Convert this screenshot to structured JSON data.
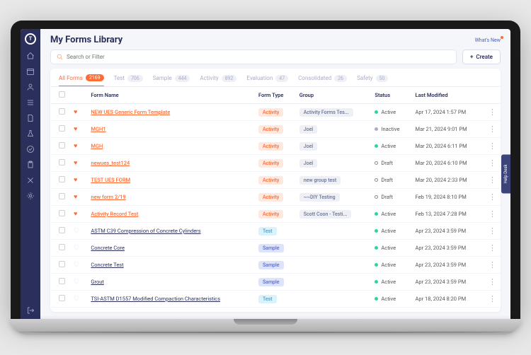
{
  "header": {
    "title": "My Forms Library",
    "whats_new": "What's New",
    "search_placeholder": "Search or Filter",
    "create_label": "Create"
  },
  "tabs": [
    {
      "label": "All Forms",
      "count": "2169",
      "active": true
    },
    {
      "label": "Test",
      "count": "706"
    },
    {
      "label": "Sample",
      "count": "444"
    },
    {
      "label": "Activity",
      "count": "892"
    },
    {
      "label": "Evaluation",
      "count": "47"
    },
    {
      "label": "Consolidated",
      "count": "26"
    },
    {
      "label": "Safety",
      "count": "50"
    }
  ],
  "columns": {
    "name": "Form Name",
    "type": "Form Type",
    "group": "Group",
    "status": "Status",
    "modified": "Last Modified"
  },
  "rows": [
    {
      "fav": true,
      "name": "NEW UES Generic Form Template",
      "type": "Activity",
      "group": "Activity Forms Tes...",
      "status": "Active",
      "modified": "Apr 17, 2024 1:57 PM"
    },
    {
      "fav": true,
      "name": "MGH1",
      "type": "Activity",
      "group": "Joel",
      "status": "Inactive",
      "modified": "Mar 21, 2024 9:01 PM"
    },
    {
      "fav": true,
      "name": "MGH",
      "type": "Activity",
      "group": "Joel",
      "status": "Active",
      "modified": "Mar 20, 2024 6:11 PM"
    },
    {
      "fav": true,
      "name": "newues_test124",
      "type": "Activity",
      "group": "Joel",
      "status": "Draft",
      "modified": "Mar 20, 2024 6:10 PM"
    },
    {
      "fav": true,
      "name": "TEST UES FORM",
      "type": "Activity",
      "group": "new group test",
      "status": "Draft",
      "modified": "Mar 20, 2024 2:33 PM"
    },
    {
      "fav": true,
      "name": "new form 2/19",
      "type": "Activity",
      "group": "~~DIY Testing",
      "status": "Draft",
      "modified": "Feb 19, 2024 8:10 PM"
    },
    {
      "fav": true,
      "name": "Activity Record Test",
      "type": "Activity",
      "group": "Scott Coon - Testi...",
      "status": "Active",
      "modified": "Feb 13, 2024 7:28 PM"
    },
    {
      "fav": false,
      "name": "ASTM C39 Compression of Concrete Cylinders",
      "type": "Test",
      "group": "",
      "status": "Active",
      "modified": "Apr 23, 2024 3:59 PM"
    },
    {
      "fav": false,
      "name": "Concrete Core",
      "type": "Sample",
      "group": "",
      "status": "Active",
      "modified": "Apr 23, 2024 3:59 PM"
    },
    {
      "fav": false,
      "name": "Concrete Test",
      "type": "Sample",
      "group": "",
      "status": "Active",
      "modified": "Apr 23, 2024 3:59 PM"
    },
    {
      "fav": false,
      "name": "Grout",
      "type": "Sample",
      "group": "",
      "status": "Active",
      "modified": "Apr 23, 2024 3:59 PM"
    },
    {
      "fav": false,
      "name": "TSI-ASTM D1557 Modified Compaction Characteristics",
      "type": "Test",
      "group": "",
      "status": "Active",
      "modified": "Apr 18, 2024 8:20 PM"
    }
  ],
  "help_desk": "Help Desk"
}
